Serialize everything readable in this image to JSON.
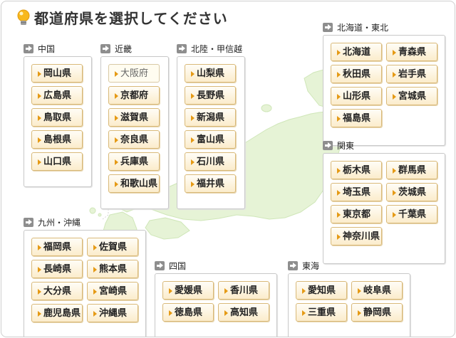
{
  "title": "都道府県を選択してください",
  "title_icon": "lightbulb-icon",
  "colors": {
    "map_land": "#e6f3d6",
    "button_top": "#fffdf7",
    "button_bottom": "#fbeccb",
    "button_border": "#d9b979",
    "button_bullet": "#e59a15",
    "region_arrow": "#8e8e8e"
  },
  "regions": [
    {
      "id": "chugoku",
      "name": "中国",
      "prefectures": [
        {
          "name": "岡山県"
        },
        {
          "name": "広島県"
        },
        {
          "name": "鳥取県"
        },
        {
          "name": "島根県"
        },
        {
          "name": "山口県"
        }
      ]
    },
    {
      "id": "kinki",
      "name": "近畿",
      "prefectures": [
        {
          "name": "大阪府",
          "selected": true
        },
        {
          "name": "京都府"
        },
        {
          "name": "滋賀県"
        },
        {
          "name": "奈良県"
        },
        {
          "name": "兵庫県"
        },
        {
          "name": "和歌山県"
        }
      ]
    },
    {
      "id": "hokuriku",
      "name": "北陸・甲信越",
      "prefectures": [
        {
          "name": "山梨県"
        },
        {
          "name": "長野県"
        },
        {
          "name": "新潟県"
        },
        {
          "name": "富山県"
        },
        {
          "name": "石川県"
        },
        {
          "name": "福井県"
        }
      ]
    },
    {
      "id": "tohoku",
      "name": "北海道・東北",
      "prefectures": [
        {
          "name": "北海道"
        },
        {
          "name": "青森県"
        },
        {
          "name": "秋田県"
        },
        {
          "name": "岩手県"
        },
        {
          "name": "山形県"
        },
        {
          "name": "宮城県"
        },
        {
          "name": "福島県"
        }
      ]
    },
    {
      "id": "kanto",
      "name": "関東",
      "prefectures": [
        {
          "name": "栃木県"
        },
        {
          "name": "群馬県"
        },
        {
          "name": "埼玉県"
        },
        {
          "name": "茨城県"
        },
        {
          "name": "東京都"
        },
        {
          "name": "千葉県"
        },
        {
          "name": "神奈川県"
        }
      ]
    },
    {
      "id": "kyushu",
      "name": "九州・沖縄",
      "prefectures": [
        {
          "name": "福岡県"
        },
        {
          "name": "佐賀県"
        },
        {
          "name": "長崎県"
        },
        {
          "name": "熊本県"
        },
        {
          "name": "大分県"
        },
        {
          "name": "宮崎県"
        },
        {
          "name": "鹿児島県"
        },
        {
          "name": "沖縄県"
        }
      ]
    },
    {
      "id": "shikoku",
      "name": "四国",
      "prefectures": [
        {
          "name": "愛媛県"
        },
        {
          "name": "香川県"
        },
        {
          "name": "徳島県"
        },
        {
          "name": "高知県"
        }
      ]
    },
    {
      "id": "tokai",
      "name": "東海",
      "prefectures": [
        {
          "name": "愛知県"
        },
        {
          "name": "岐阜県"
        },
        {
          "name": "三重県"
        },
        {
          "name": "静岡県"
        }
      ]
    }
  ]
}
